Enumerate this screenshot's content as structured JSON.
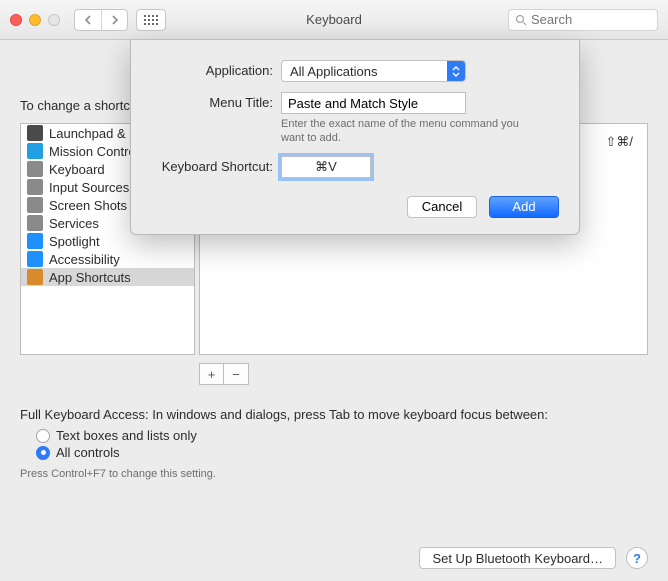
{
  "window": {
    "title": "Keyboard",
    "search_placeholder": "Search"
  },
  "content": {
    "top_hint": "To change a shortcut, select it, click the key combination, and then type the new keys.",
    "sidebar": {
      "items": [
        {
          "label": "Launchpad & Dock",
          "icon": "launchpad-icon",
          "color": "#4a4a4a"
        },
        {
          "label": "Mission Control",
          "icon": "mission-control-icon",
          "color": "#20a0e0"
        },
        {
          "label": "Keyboard",
          "icon": "keyboard-icon",
          "color": "#8a8a8a"
        },
        {
          "label": "Input Sources",
          "icon": "input-sources-icon",
          "color": "#8a8a8a"
        },
        {
          "label": "Screen Shots",
          "icon": "screenshot-icon",
          "color": "#8a8a8a"
        },
        {
          "label": "Services",
          "icon": "services-icon",
          "color": "#8a8a8a"
        },
        {
          "label": "Spotlight",
          "icon": "spotlight-icon",
          "color": "#1e90ff"
        },
        {
          "label": "Accessibility",
          "icon": "accessibility-icon",
          "color": "#1e90ff"
        },
        {
          "label": "App Shortcuts",
          "icon": "app-shortcuts-icon",
          "color": "#d88b2a",
          "selected": true
        }
      ]
    },
    "shortcut_display": "⇧⌘/",
    "add_label": "+",
    "remove_label": "−",
    "fka": {
      "title": "Full Keyboard Access: In windows and dialogs, press Tab to move keyboard focus between:",
      "option1": "Text boxes and lists only",
      "option2": "All controls",
      "selected": "option2",
      "hint": "Press Control+F7 to change this setting."
    }
  },
  "footer": {
    "bluetooth_label": "Set Up Bluetooth Keyboard…",
    "help_label": "?"
  },
  "sheet": {
    "application_label": "Application:",
    "application_value": "All Applications",
    "menu_title_label": "Menu Title:",
    "menu_title_value": "Paste and Match Style",
    "menu_title_hint": "Enter the exact name of the menu command you want to add.",
    "shortcut_label": "Keyboard Shortcut:",
    "shortcut_value": "⌘V",
    "cancel_label": "Cancel",
    "add_label": "Add"
  }
}
